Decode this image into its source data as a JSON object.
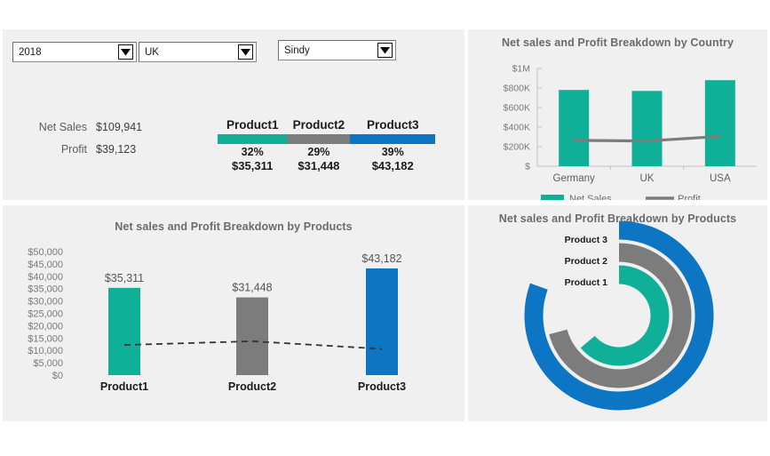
{
  "colors": {
    "teal": "#0faf98",
    "gray": "#7c7c7c",
    "blue": "#0c76c4",
    "panel_bg": "#f0f0f0",
    "page_bg": "#ffffff",
    "title_text": "#6b6b6b",
    "axis_text": "#7a7a7a"
  },
  "filters": {
    "year": {
      "value": "2018",
      "icon": "chevron-down-icon"
    },
    "region": {
      "value": "UK",
      "icon": "chevron-down-icon"
    },
    "person": {
      "value": "Sindy",
      "icon": "chevron-down-icon"
    }
  },
  "kpi": {
    "net_sales_label": "Net Sales",
    "net_sales_value": "$109,941",
    "profit_label": "Profit",
    "profit_value": "$39,123"
  },
  "share": {
    "products": [
      {
        "name": "Product1",
        "percent": "32%",
        "value": "$35,311",
        "fraction": 32,
        "color": "#0faf98"
      },
      {
        "name": "Product2",
        "percent": "29%",
        "value": "$31,448",
        "fraction": 29,
        "color": "#7c7c7c"
      },
      {
        "name": "Product3",
        "percent": "39%",
        "value": "$43,182",
        "fraction": 39,
        "color": "#0c76c4"
      }
    ]
  },
  "chart_data": [
    {
      "id": "country",
      "type": "bar",
      "title": "Net sales and Profit Breakdown by Country",
      "categories": [
        "Germany",
        "UK",
        "USA"
      ],
      "series": [
        {
          "name": "Net Sales",
          "type": "bar",
          "color": "#0faf98",
          "values": [
            780000,
            770000,
            880000
          ]
        },
        {
          "name": "Profit",
          "type": "line",
          "color": "#7c7c7c",
          "values": [
            265000,
            258000,
            305000
          ]
        }
      ],
      "ylim": [
        0,
        1000000
      ],
      "yticks": [
        0,
        200000,
        400000,
        600000,
        800000,
        1000000
      ],
      "ytick_labels": [
        "$",
        "$200K",
        "$400K",
        "$600K",
        "$800K",
        "$1M"
      ],
      "xlabel": "",
      "ylabel": "",
      "grid": false,
      "legend": [
        "Net Sales",
        "Profit"
      ],
      "legend_position": "bottom"
    },
    {
      "id": "products",
      "type": "bar",
      "title": "Net sales and Profit Breakdown by Products",
      "categories": [
        "Product1",
        "Product2",
        "Product3"
      ],
      "series": [
        {
          "name": "Net Sales",
          "type": "bar",
          "colors": [
            "#0faf98",
            "#7c7c7c",
            "#0c76c4"
          ],
          "values": [
            35311,
            31448,
            43182
          ],
          "labels": [
            "$35,311",
            "$31,448",
            "$43,182"
          ]
        },
        {
          "name": "Profit",
          "type": "line",
          "style": "dashed",
          "color": "#333333",
          "values": [
            12200,
            13700,
            10600
          ]
        }
      ],
      "ylim": [
        0,
        50000
      ],
      "yticks": [
        0,
        5000,
        10000,
        15000,
        20000,
        25000,
        30000,
        35000,
        40000,
        45000,
        50000
      ],
      "ytick_labels": [
        "$0",
        "$5,000",
        "$10,000",
        "$15,000",
        "$20,000",
        "$25,000",
        "$30,000",
        "$35,000",
        "$40,000",
        "$45,000",
        "$50,000"
      ],
      "xlabel": "",
      "ylabel": "",
      "grid": false,
      "legend": [],
      "legend_position": "none"
    },
    {
      "id": "radial",
      "type": "pie",
      "subtype": "radial-bar",
      "title": "Net sales and Profit Breakdown by Products",
      "categories": [
        "Product 1",
        "Product 2",
        "Product 3"
      ],
      "values": [
        32,
        29,
        39
      ],
      "sweep_degrees": [
        230,
        255,
        290
      ],
      "colors": [
        "#0faf98",
        "#7c7c7c",
        "#0c76c4"
      ],
      "labels": [
        "Product 1",
        "Product 2",
        "Product 3"
      ],
      "legend": [
        "Product 1",
        "Product 2",
        "Product 3"
      ],
      "legend_position": "inside-top-left"
    }
  ]
}
